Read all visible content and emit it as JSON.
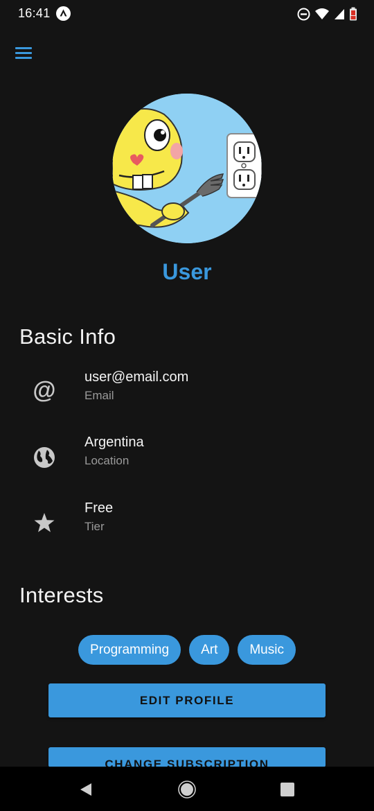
{
  "status_bar": {
    "time": "16:41",
    "icons": [
      "app-notification-icon",
      "do-not-disturb-icon",
      "wifi-icon",
      "signal-icon",
      "battery-low-icon"
    ]
  },
  "app_bar": {
    "menu_icon": "hamburger-menu-icon",
    "accent_color": "#3a98dd"
  },
  "profile": {
    "avatar_icon": "profile-avatar-cartoon",
    "name": "User"
  },
  "basic_info": {
    "title": "Basic Info",
    "items": [
      {
        "icon": "at-icon",
        "value": "user@email.com",
        "label": "Email"
      },
      {
        "icon": "globe-icon",
        "value": "Argentina",
        "label": "Location"
      },
      {
        "icon": "star-icon",
        "value": "Free",
        "label": "Tier"
      }
    ]
  },
  "interests": {
    "title": "Interests",
    "chips": [
      "Programming",
      "Art",
      "Music"
    ]
  },
  "actions": {
    "edit_profile": "EDIT PROFILE",
    "change_subscription": "CHANGE SUBSCRIPTION"
  },
  "nav_bar": {
    "icons": [
      "back-icon",
      "home-icon",
      "recents-icon"
    ]
  }
}
